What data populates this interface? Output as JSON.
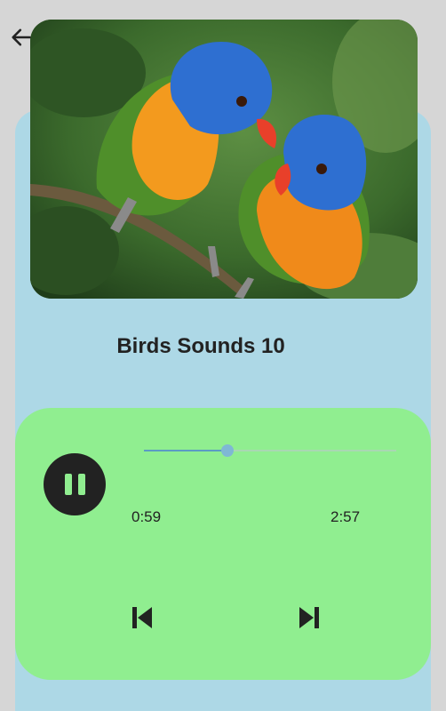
{
  "track": {
    "title": "Birds Sounds 10",
    "elapsed": "0:59",
    "duration": "2:57",
    "progress": 0.33
  },
  "icons": {
    "back": "arrow-left-icon",
    "play_pause": "pause-icon",
    "previous": "skip-previous-icon",
    "next": "skip-next-icon"
  },
  "colors": {
    "background": "#d6d6d6",
    "card": "#add8e6",
    "player": "#90ee90",
    "button": "#222222",
    "slider_active": "#5b9bc4",
    "slider_thumb": "#7fb8d4"
  }
}
